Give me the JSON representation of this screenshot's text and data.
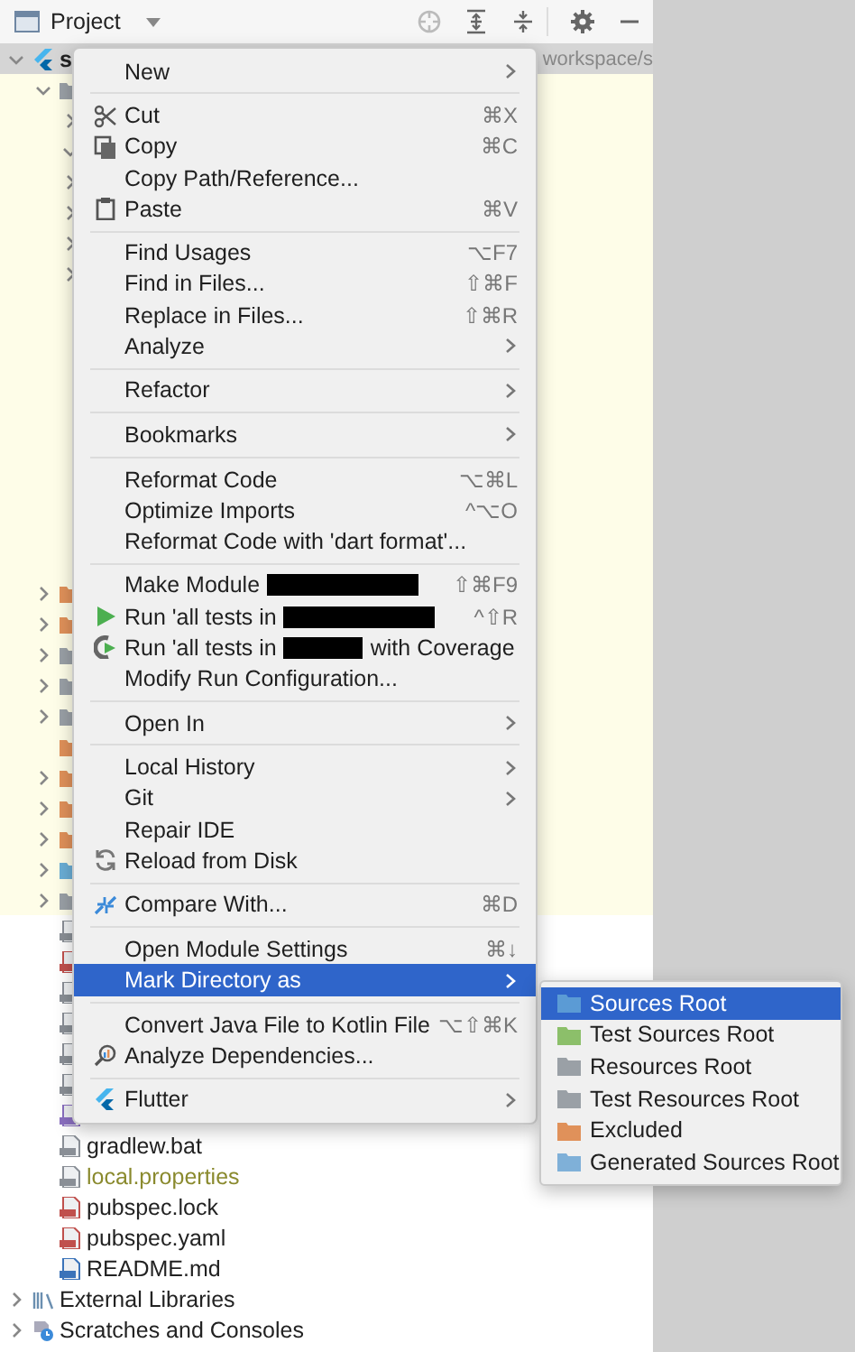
{
  "tool_window": {
    "title": "Project"
  },
  "tree": [
    {
      "kind": "project",
      "name": "s",
      "path": "workspace/s",
      "selected": true,
      "expanded": true,
      "children": [
        {
          "kind": "folder",
          "color": "#9aa0a6",
          "expanded": true,
          "children": [
            {
              "expanded": false
            },
            {
              "expanded": true
            },
            {
              "expanded": false
            },
            {
              "expanded": false
            },
            {
              "expanded": false
            },
            {
              "expanded": false
            }
          ]
        },
        {
          "kind": "folder",
          "color": "#e0915a",
          "expanded": false
        },
        {
          "kind": "folder",
          "color": "#e0915a",
          "expanded": false
        },
        {
          "kind": "folder",
          "color": "#9aa0a6",
          "expanded": false
        },
        {
          "kind": "folder",
          "color": "#9aa0a6",
          "expanded": false
        },
        {
          "kind": "folder",
          "color": "#9aa0a6",
          "expanded": false
        },
        {
          "kind": "folder",
          "color": "#e0915a"
        },
        {
          "kind": "folder",
          "color": "#e0915a",
          "expanded": false
        },
        {
          "kind": "folder",
          "color": "#e0915a",
          "expanded": false
        },
        {
          "kind": "folder",
          "color": "#e0915a",
          "expanded": false
        },
        {
          "kind": "folder",
          "color": "#6aaed6",
          "expanded": false
        },
        {
          "kind": "folder",
          "color": "#9aa0a6",
          "expanded": false
        },
        {
          "kind": "file",
          "color": "#8a8f96"
        },
        {
          "kind": "file",
          "color": "#c0504d"
        },
        {
          "kind": "file",
          "color": "#8a8f96"
        },
        {
          "kind": "file",
          "color": "#8a8f96"
        },
        {
          "kind": "file",
          "color": "#8a8f96"
        },
        {
          "kind": "file",
          "color": "#8a8f96"
        },
        {
          "kind": "file",
          "color": "#8a6fc0"
        },
        {
          "kind": "file",
          "color": "#8a8f96",
          "name": "gradlew.bat",
          "ignored": false
        },
        {
          "kind": "file",
          "color": "#8a8f96",
          "name": "local.properties",
          "ignored": true
        },
        {
          "kind": "file",
          "color": "#c0504d",
          "name": "pubspec.lock",
          "ignored": false
        },
        {
          "kind": "file",
          "color": "#c0504d",
          "name": "pubspec.yaml",
          "ignored": false
        },
        {
          "kind": "file",
          "color": "#3b73b9",
          "name": "README.md",
          "ignored": false
        }
      ]
    },
    {
      "kind": "libraries",
      "name": "External Libraries",
      "expanded": false
    },
    {
      "kind": "scratches",
      "name": "Scratches and Consoles",
      "expanded": false
    }
  ],
  "context_menu": [
    {
      "kind": "item",
      "label": "New",
      "submenu": true,
      "selected": false
    },
    {
      "kind": "separator"
    },
    {
      "kind": "item",
      "label": "Cut",
      "shortcut": "⌘X",
      "selected": false
    },
    {
      "kind": "item",
      "label": "Copy",
      "shortcut": "⌘C",
      "selected": false
    },
    {
      "kind": "item",
      "label": "Copy Path/Reference...",
      "selected": false
    },
    {
      "kind": "item",
      "label": "Paste",
      "shortcut": "⌘V",
      "selected": false
    },
    {
      "kind": "separator"
    },
    {
      "kind": "item",
      "label": "Find Usages",
      "shortcut": "⌥F7",
      "selected": false
    },
    {
      "kind": "item",
      "label": "Find in Files...",
      "shortcut": "⇧⌘F",
      "selected": false
    },
    {
      "kind": "item",
      "label": "Replace in Files...",
      "shortcut": "⇧⌘R",
      "selected": false
    },
    {
      "kind": "item",
      "label": "Analyze",
      "submenu": true,
      "selected": false
    },
    {
      "kind": "separator"
    },
    {
      "kind": "item",
      "label": "Refactor",
      "submenu": true,
      "selected": false
    },
    {
      "kind": "separator"
    },
    {
      "kind": "item",
      "label": "Bookmarks",
      "submenu": true,
      "selected": false
    },
    {
      "kind": "separator"
    },
    {
      "kind": "item",
      "label": "Reformat Code",
      "shortcut": "⌥⌘L",
      "selected": false
    },
    {
      "kind": "item",
      "label": "Optimize Imports",
      "shortcut": "^⌥O",
      "selected": false
    },
    {
      "kind": "item",
      "label": "Reformat Code with 'dart format'...",
      "selected": false
    },
    {
      "kind": "separator"
    },
    {
      "kind": "item",
      "label": "Make Module",
      "redacted": true,
      "shortcut": "⇧⌘F9",
      "selected": false
    },
    {
      "kind": "item",
      "label": "Run 'all tests in",
      "redacted": true,
      "shortcut": "^⇧R",
      "selected": false
    },
    {
      "kind": "item",
      "label": "Run 'all tests in",
      "redacted": true,
      "label_end": "with Coverage",
      "selected": false
    },
    {
      "kind": "item",
      "label": "Modify Run Configuration...",
      "selected": false
    },
    {
      "kind": "separator"
    },
    {
      "kind": "item",
      "label": "Open In",
      "submenu": true,
      "selected": false
    },
    {
      "kind": "separator"
    },
    {
      "kind": "item",
      "label": "Local History",
      "submenu": true,
      "selected": false
    },
    {
      "kind": "item",
      "label": "Git",
      "submenu": true,
      "selected": false
    },
    {
      "kind": "item",
      "label": "Repair IDE",
      "selected": false
    },
    {
      "kind": "item",
      "label": "Reload from Disk",
      "selected": false
    },
    {
      "kind": "separator"
    },
    {
      "kind": "item",
      "label": "Compare With...",
      "shortcut": "⌘D",
      "selected": false
    },
    {
      "kind": "separator"
    },
    {
      "kind": "item",
      "label": "Open Module Settings",
      "shortcut": "⌘↓",
      "selected": false
    },
    {
      "kind": "item",
      "label": "Mark Directory as",
      "submenu": true,
      "selected": true
    },
    {
      "kind": "separator"
    },
    {
      "kind": "item",
      "label": "Convert Java File to Kotlin File",
      "shortcut": "⌥⇧⌘K",
      "selected": false
    },
    {
      "kind": "item",
      "label": "Analyze Dependencies...",
      "selected": false
    },
    {
      "kind": "separator"
    },
    {
      "kind": "item",
      "label": "Flutter",
      "submenu": true,
      "selected": false
    }
  ],
  "submenu": [
    {
      "label": "Sources Root",
      "color": "#5b9bd5",
      "selected": true
    },
    {
      "label": "Test Sources Root",
      "color": "#8cbf6a",
      "selected": false
    },
    {
      "label": "Resources Root",
      "color": "#9aa0a6",
      "selected": false
    },
    {
      "label": "Test Resources Root",
      "color": "#9aa0a6",
      "selected": false
    },
    {
      "label": "Excluded",
      "color": "#e0915a",
      "selected": false
    },
    {
      "label": "Generated Sources Root",
      "color": "#7fb0d8",
      "selected": false
    }
  ]
}
